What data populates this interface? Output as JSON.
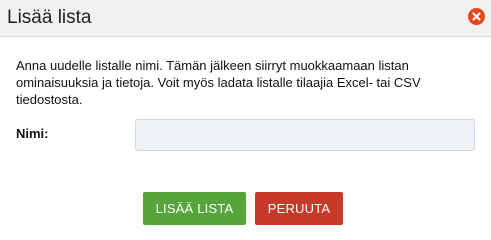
{
  "dialog": {
    "title": "Lisää lista",
    "close_icon": "close-x-circle-icon",
    "description": "Anna uudelle listalle nimi. Tämän jälkeen siirryt muokkaamaan listan ominaisuuksia ja tietoja. Voit myös ladata listalle tilaajia Excel- tai CSV tiedostosta.",
    "name_label": "Nimi:",
    "name_value": "",
    "name_placeholder": "",
    "add_button_label": "LISÄÄ LISTA",
    "cancel_button_label": "PERUUTA"
  },
  "colors": {
    "titlebar_bg": "#f1f1f1",
    "close_icon": "#e8461b",
    "add_button": "#56a53c",
    "cancel_button": "#c73a2a",
    "input_bg": "#eef2f7"
  }
}
